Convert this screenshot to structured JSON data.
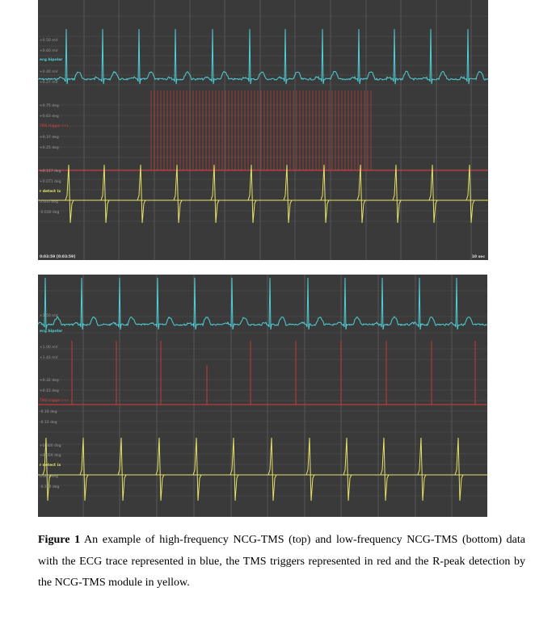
{
  "figure": {
    "top_panel": {
      "ecg_labels": [
        "+0.50 mV",
        "+0.60 mV",
        "ecg bipolar",
        "+0.40 mV",
        "+0.27 mV"
      ],
      "trigger_labels": [
        "+0.75 deg",
        "+0.63 deg",
        "TMS trigger (+)",
        "+0.37 deg",
        "+0.25 deg"
      ],
      "detect_labels": [
        "+0.117 deg",
        "+0.071 deg",
        "r detect ix",
        "0.000 deg",
        "-0.030 deg"
      ],
      "time_left": "0:03:59 [0:03:59]",
      "time_right": "10 sec"
    },
    "bottom_panel": {
      "ecg_labels": [
        "+1.50 mV",
        "ecg bipolar"
      ],
      "trigger_labels": [
        "+1.00 mV",
        "+1.43 mV",
        "+0.32 deg",
        "+0.15 deg",
        "TMS trigger (+)",
        "-0.10 deg",
        "-0.12 deg"
      ],
      "detect_labels": [
        "+0.300 deg",
        "+0.050 deg",
        "r detect ix",
        "0.000 deg",
        "-0.300 deg"
      ]
    },
    "colors": {
      "background": "#3a3a3a",
      "grid": "#6a6a6a",
      "ecg": "#4fd0d8",
      "trigger": "#e23a3a",
      "detect": "#e8e26a"
    },
    "caption": {
      "label": "Figure 1",
      "text": " An example of high-frequency NCG-TMS (top) and low-frequency NCG-TMS (bottom) data with the ECG trace represented in blue, the TMS triggers represented in red and the R-peak detection by the NCG-TMS module in yellow."
    }
  }
}
